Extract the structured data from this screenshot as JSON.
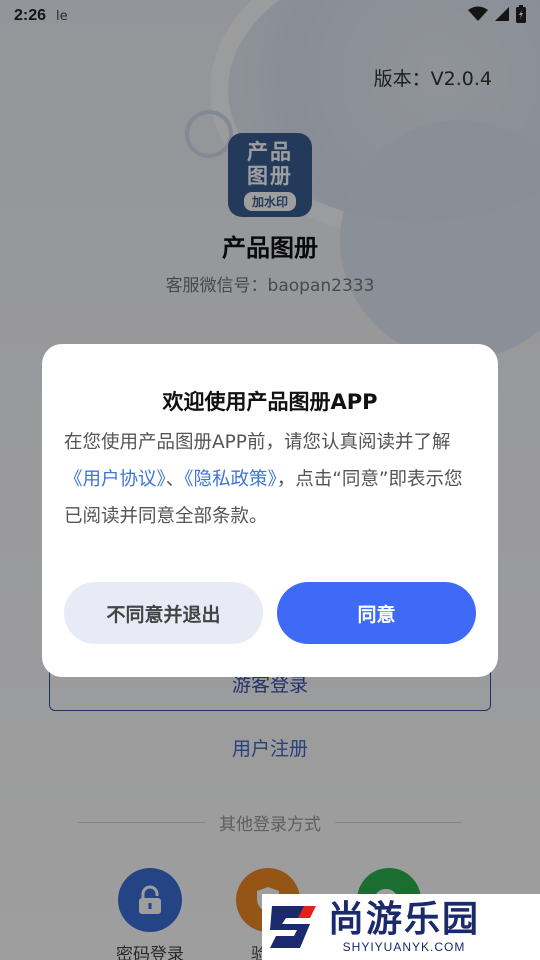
{
  "status_bar": {
    "time": "2:26",
    "extra": "le"
  },
  "version": "版本：V2.0.4",
  "app": {
    "logo_line1": "产品",
    "logo_line2": "图册",
    "logo_badge": "加水印",
    "name": "产品图册",
    "service": "客服微信号：baopan2333"
  },
  "login": {
    "guest_label": "游客登录",
    "register_label": "用户注册",
    "other_methods": "其他登录方式",
    "options": [
      {
        "label": "密码登录",
        "icon": "lock-icon",
        "color": "#3b6fd8"
      },
      {
        "label": "验证",
        "icon": "shield-icon",
        "color": "#f08a24"
      },
      {
        "label": "",
        "icon": "wechat-icon",
        "color": "#2bb24c"
      }
    ]
  },
  "dialog": {
    "title": "欢迎使用产品图册APP",
    "body_part1": "在您使用产品图册APP前，请您认真阅读并了解",
    "link_user_agreement": "《用户协议》",
    "separator": "、",
    "link_privacy": "《隐私政策》",
    "body_part2": "，点击“同意”即表示您已阅读并同意全部条款。",
    "disagree_label": "不同意并退出",
    "agree_label": "同意"
  },
  "watermark": {
    "cn": "尚游乐园",
    "en": "SHYIYUANYK.COM"
  },
  "colors": {
    "primary": "#3f6af7",
    "link": "#3f74d8",
    "disagree_bg": "#e8ebf6"
  }
}
